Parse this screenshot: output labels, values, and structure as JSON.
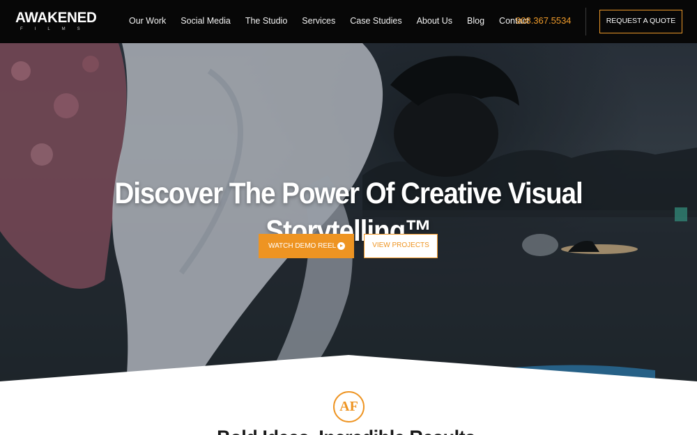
{
  "brand": {
    "logo_main": "AWAKENED",
    "logo_sub": "FILMS"
  },
  "nav": {
    "items": [
      {
        "label": "Our Work"
      },
      {
        "label": "Social Media"
      },
      {
        "label": "The Studio"
      },
      {
        "label": "Services"
      },
      {
        "label": "Case Studies"
      },
      {
        "label": "About Us"
      },
      {
        "label": "Blog"
      },
      {
        "label": "Contact"
      }
    ],
    "phone": "908.367.5534",
    "quote_button": "REQUEST A QUOTE"
  },
  "hero": {
    "title": "Discover The Power Of Creative Visual Storytelling™",
    "demo_button": "WATCH DEMO REEL",
    "projects_button": "VIEW PROJECTS"
  },
  "section": {
    "badge": "AF",
    "title": "Bold Ideas. Incredible Results."
  },
  "colors": {
    "accent": "#ee9422",
    "header_bg": "#070707"
  },
  "icons": {
    "demo_button_icon": "play-circle-icon"
  }
}
